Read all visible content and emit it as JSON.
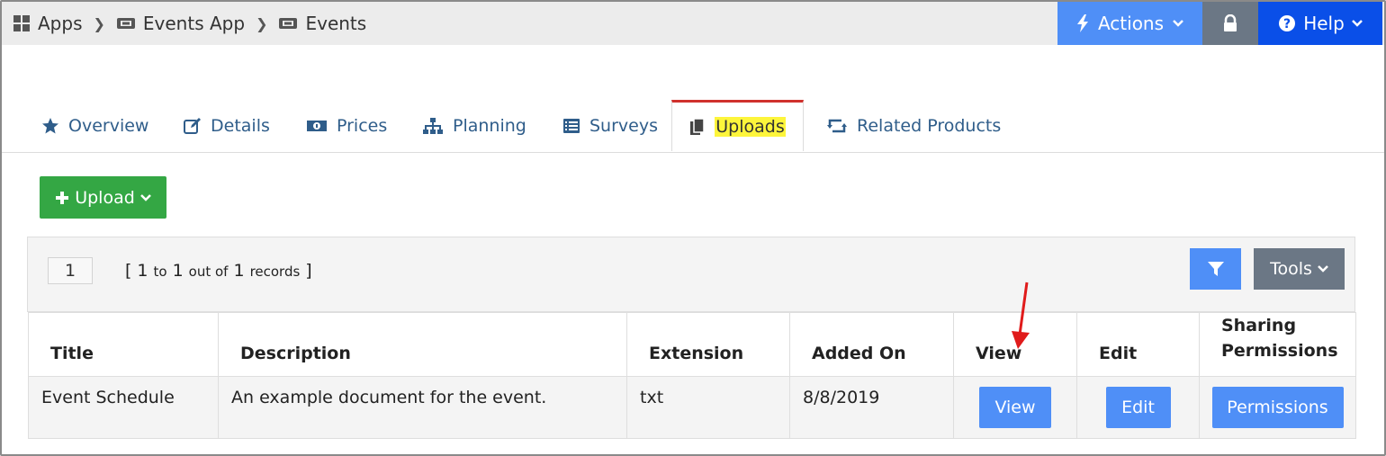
{
  "breadcrumb": {
    "items": [
      {
        "label": "Apps",
        "icon": "grid-icon"
      },
      {
        "label": "Events App",
        "icon": "ticket-icon"
      },
      {
        "label": "Events",
        "icon": "ticket-icon"
      }
    ]
  },
  "header": {
    "actions_label": "Actions",
    "help_label": "Help"
  },
  "tabs": [
    {
      "label": "Overview",
      "icon": "star-icon"
    },
    {
      "label": "Details",
      "icon": "edit-icon"
    },
    {
      "label": "Prices",
      "icon": "money-icon"
    },
    {
      "label": "Planning",
      "icon": "sitemap-icon"
    },
    {
      "label": "Surveys",
      "icon": "list-icon"
    },
    {
      "label": "Uploads",
      "icon": "files-icon",
      "active": true
    },
    {
      "label": "Related Products",
      "icon": "retweet-icon"
    }
  ],
  "toolbar": {
    "upload_label": "Upload",
    "tools_label": "Tools"
  },
  "pager": {
    "page": "1",
    "from": "1",
    "to_word": "to",
    "to": "1",
    "out_of_word": "out of",
    "total": "1",
    "records_word": "records"
  },
  "table": {
    "columns": [
      "Title",
      "Description",
      "Extension",
      "Added On",
      "View",
      "Edit",
      "Sharing Permissions"
    ],
    "rows": [
      {
        "title": "Event Schedule",
        "description": "An example document for the event.",
        "extension": "txt",
        "added_on": "8/8/2019",
        "view_label": "View",
        "edit_label": "Edit",
        "permissions_label": "Permissions"
      }
    ]
  },
  "colors": {
    "accent_blue": "#4f8ff7",
    "help_blue": "#0a4fe8",
    "upload_green": "#34a744",
    "gray_button": "#6b7785",
    "active_tab_border": "#d0312d",
    "highlight": "#fdf53b",
    "annotation_arrow": "#e01b1b"
  }
}
